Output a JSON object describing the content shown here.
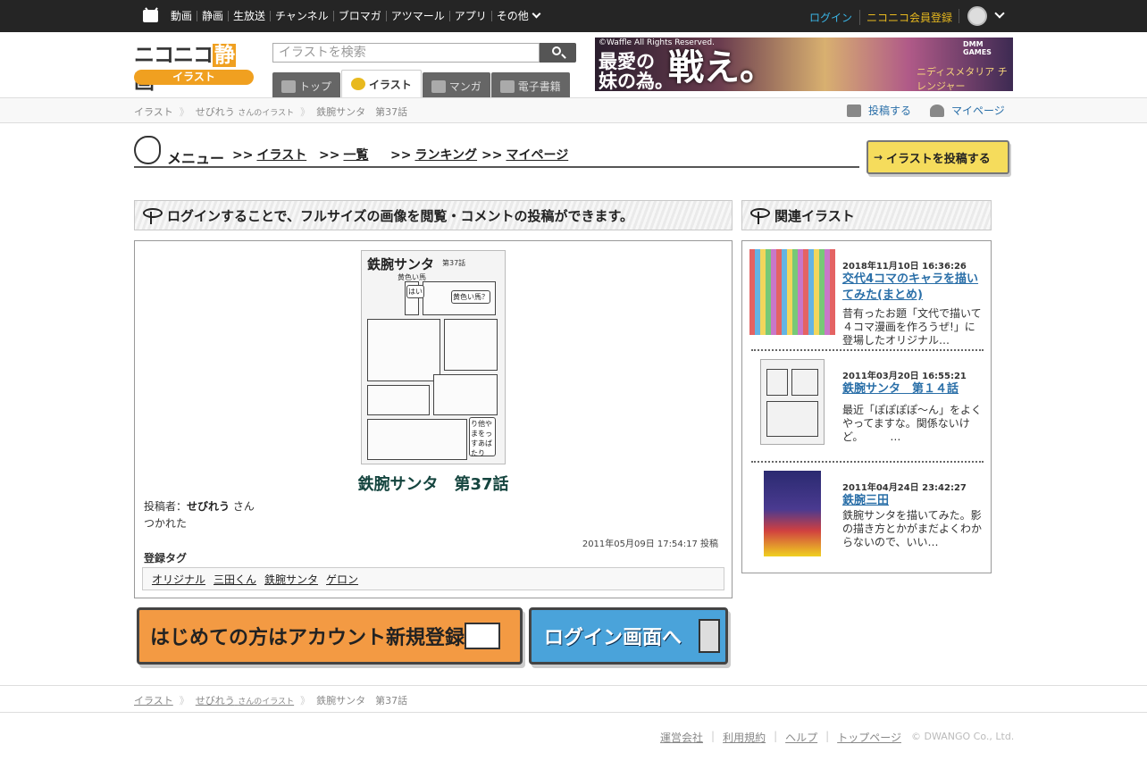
{
  "topbar": {
    "nav": [
      "動画",
      "静画",
      "生放送",
      "チャンネル",
      "ブロマガ",
      "アツマール",
      "アプリ",
      "その他"
    ],
    "login": "ログイン",
    "signup": "ニコニコ会員登録"
  },
  "header": {
    "logo_main_a": "ニコニコ",
    "logo_main_b": "静",
    "logo_main_c": "画",
    "logo_sub": "イラスト",
    "search_placeholder": "イラストを検索",
    "tabs": [
      "トップ",
      "イラスト",
      "マンガ",
      "電子書籍"
    ],
    "banner": {
      "copyright": "©Waffle All Rights Reserved.",
      "line1a": "最愛の",
      "line1b": "妹の為。",
      "line2": "戦え。",
      "logo": "ニディスメタリア チレンジャー",
      "brand": "DMM GAMES"
    }
  },
  "breadcrumb": {
    "home": "イラスト",
    "user": "せびれう",
    "user_suffix": "さんのイラスト",
    "current": "鉄腕サンタ　第37話",
    "post": "投稿する",
    "mypage": "マイページ"
  },
  "menu": {
    "title": "メニュー",
    "links": [
      "イラスト",
      "一覧",
      "ランキング",
      "マイページ"
    ],
    "prefix": ">>",
    "upload": "イラストを投稿する"
  },
  "main": {
    "header": "ログインすることで、フルサイズの画像を閲覧・コメントの投稿ができます。",
    "art": {
      "title": "鉄腕サンタ",
      "episode": "第37話",
      "subtitle": "黄色い馬",
      "bubble1": "黄色い馬？",
      "bubble2": "はい",
      "bubble3": "り他やまをっすあばたり"
    },
    "title": "鉄腕サンタ　第37話",
    "poster_label": "投稿者：",
    "poster_name": "せびれう",
    "poster_suffix": "さん",
    "description": "つかれた",
    "posted_at": "2011年05月09日 17:54:17 投稿",
    "tags_heading": "登録タグ",
    "tags": [
      "オリジナル",
      "三田くん",
      "鉄腕サンタ",
      "ゲロン"
    ]
  },
  "cta": {
    "register": "はじめての方はアカウント新規登録へ",
    "login": "ログイン画面へ"
  },
  "related": {
    "header": "関連イラスト",
    "items": [
      {
        "date": "2018年11月10日 16:36:26",
        "title": "交代4コマのキャラを描いてみた(まとめ)",
        "desc": "昔有ったお題「文代で描いて４コマ漫画を作ろうぜ!」に登場したオリジナル…"
      },
      {
        "date": "2011年03月20日 16:55:21",
        "title": "鉄腕サンタ　第１４話",
        "desc": "最近「ぽぽぽぽ～ん」をよくやってますな。関係ないけど。　　　…"
      },
      {
        "date": "2011年04月24日 23:42:27",
        "title": "鉄腕三田",
        "desc": "鉄腕サンタを描いてみた。影の描き方とかがまだよくわからないので、いい…"
      }
    ]
  },
  "footer": {
    "links": [
      "運営会社",
      "利用規約",
      "ヘルプ",
      "トップページ"
    ],
    "copyright": "© DWANGO Co., Ltd."
  }
}
